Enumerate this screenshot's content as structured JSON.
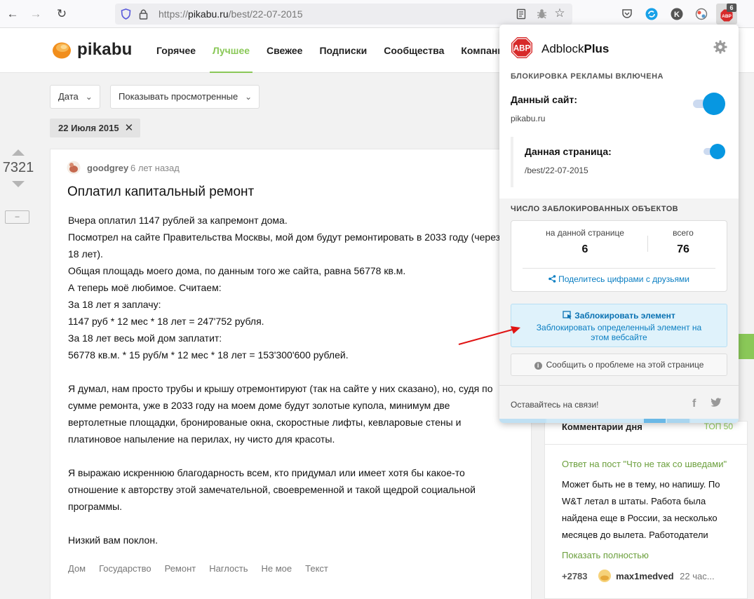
{
  "browser": {
    "url_prefix": "https://",
    "url_domain": "pikabu.ru",
    "url_path": "/best/22-07-2015",
    "abp_badge": "6"
  },
  "site": {
    "logo_text": "pikabu",
    "nav": [
      "Горячее",
      "Лучшее",
      "Свежее",
      "Подписки",
      "Сообщества",
      "Компании"
    ],
    "active_nav": "Лучшее",
    "accent_color": "#8ac858"
  },
  "filters": {
    "date_label": "Дата",
    "viewed_label": "Показывать просмотренные",
    "date_chip": "22 Июля 2015"
  },
  "story": {
    "rating": "7321",
    "collapse": "–",
    "author": "goodgrey",
    "time": "6 лет назад",
    "title": "Оплатил капитальный ремонт",
    "body": [
      "Вчера оплатил 1147 рублей за капремонт дома.",
      "Посмотрел на сайте Правительства Москвы, мой дом будут ремонтировать в 2033 году (через",
      "18 лет).",
      "Общая площадь моего дома, по данным того же сайта, равна 56778 кв.м.",
      "А теперь моё любимое. Считаем:",
      "За 18 лет я заплачу:",
      "1147 руб * 12 мес * 18 лет = 247'752 рубля.",
      "За 18 лет весь мой дом заплатит:",
      "56778 кв.м. * 15 руб/м * 12 мес * 18 лет = 153'300'600 рублей.",
      "",
      "Я думал, нам просто трубы и крышу отремонтируют (так на сайте у них сказано), но, судя по",
      "сумме ремонта, уже в 2033 году на моем доме будут золотые купола, минимум две",
      "вертолетные площадки, бронированые окна, скоростные лифты, кевларовые стены и",
      "платиновое напыление на перилах, ну чисто для красоты.",
      "",
      "Я выражаю искреннюю благодарность всем, кто придумал или имеет хотя бы какое-то",
      "отношение к авторству этой замечательной, своевременной и такой щедрой социальной",
      "программы.",
      "",
      "Низкий вам поклон."
    ],
    "tags": [
      "Дом",
      "Государство",
      "Ремонт",
      "Наглость",
      "Не мое",
      "Текст"
    ]
  },
  "sidebar": {
    "heading": "Комментарии дня",
    "top50": "ТОП 50",
    "comment_link": "Ответ на пост \"Что не так со шведами\"",
    "comment_text": "Может быть не в тему, но напишу. По W&T летал в штаты. Работа была найдена еще в России, за несколько месяцев до вылета. Работодатели",
    "show_more": "Показать полностью",
    "score": "+2783",
    "user": "max1medved",
    "ago": "22 час..."
  },
  "abp": {
    "name_plain": "Adblock",
    "name_bold": "Plus",
    "status": "БЛОКИРОВКА РЕКЛАМЫ ВКЛЮЧЕНА",
    "site_label": "Данный сайт:",
    "site_value": "pikabu.ru",
    "page_label": "Данная страница:",
    "page_value": "/best/22-07-2015",
    "stats_title": "ЧИСЛО ЗАБЛОКИРОВАННЫХ ОБЪЕКТОВ",
    "on_page_label": "на данной странице",
    "on_page_value": "6",
    "total_label": "всего",
    "total_value": "76",
    "share": "Поделитесь цифрами с друзьями",
    "block_title": "Заблокировать элемент",
    "block_desc": "Заблокировать определенный элемент на этом вебсайте",
    "report": "Сообщить о проблеме на этой странице",
    "follow": "Оставайтесь на связи!",
    "toggle_color": "#0797e1",
    "site_toggle_on": true,
    "page_toggle_on": true
  }
}
